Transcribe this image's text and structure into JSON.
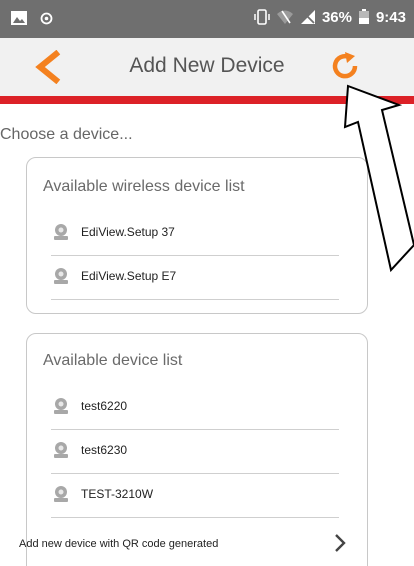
{
  "status_bar": {
    "battery_percent": "36%",
    "time": "9:43"
  },
  "header": {
    "title": "Add New Device",
    "accent_color": "#f4811f",
    "bar_color": "#dc2127"
  },
  "content": {
    "choose_label": "Choose a device...",
    "wireless_section": {
      "title": "Available wireless device list",
      "devices": [
        "EdiView.Setup 37",
        "EdiView.Setup E7"
      ]
    },
    "device_section": {
      "title": "Available device list",
      "devices": [
        "test6220",
        "test6230",
        "TEST-3210W"
      ],
      "qr_label": "Add new device with QR code generated"
    }
  },
  "icons": {
    "back": "chevron-left-icon",
    "refresh": "refresh-icon",
    "camera": "camera-icon",
    "forward": "chevron-right-icon"
  }
}
